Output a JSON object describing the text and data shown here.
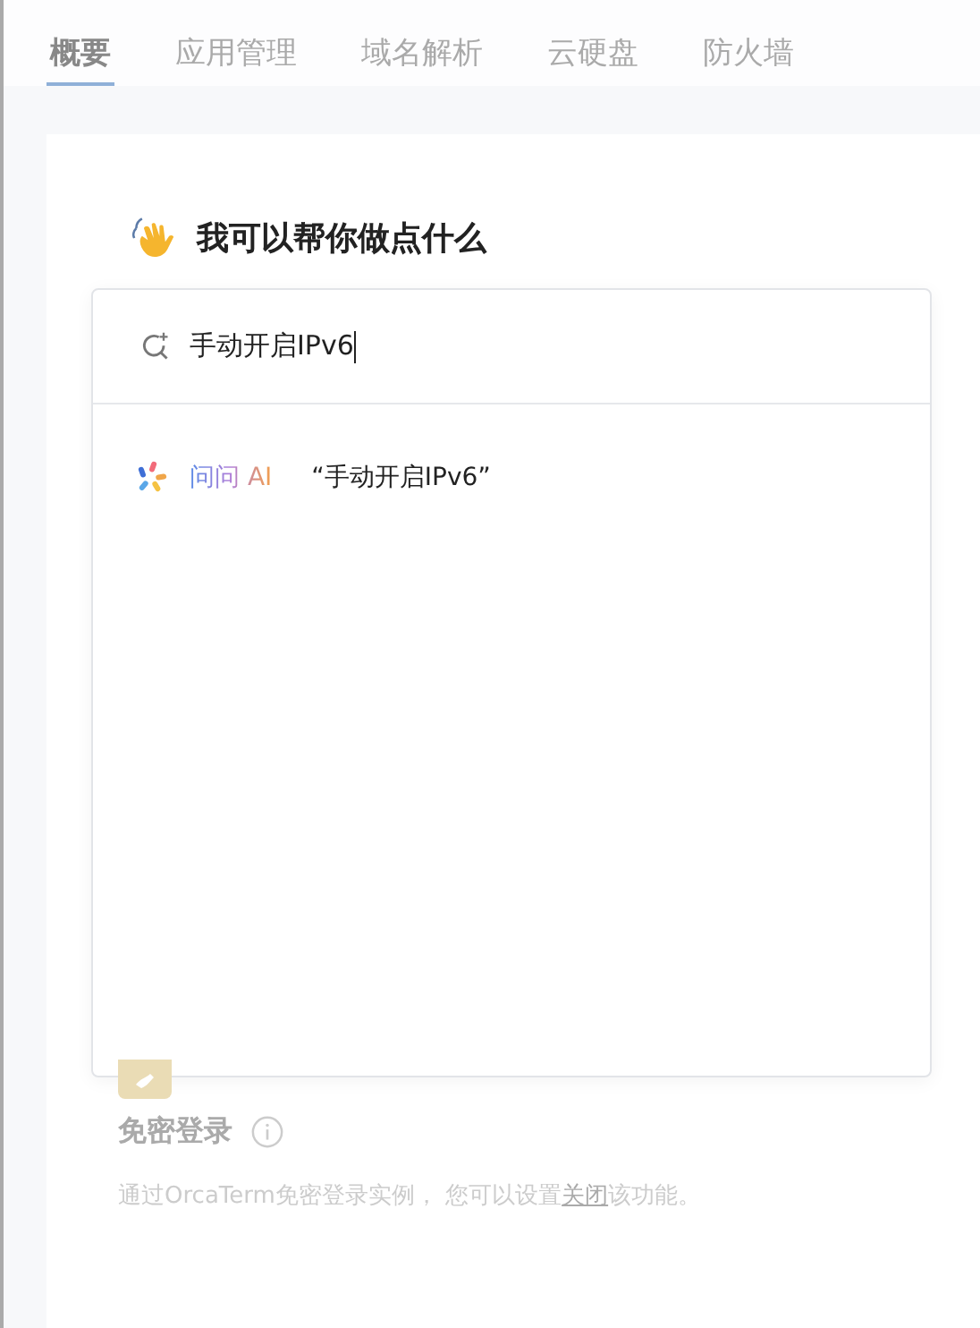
{
  "tabs": [
    {
      "label": "概要",
      "selected": true
    },
    {
      "label": "应用管理",
      "selected": false
    },
    {
      "label": "域名解析",
      "selected": false
    },
    {
      "label": "云硬盘",
      "selected": false
    },
    {
      "label": "防火墙",
      "selected": false
    }
  ],
  "assistant": {
    "heading": "我可以帮你做点什么",
    "search": {
      "value": "手动开启IPv6"
    },
    "suggestions": [
      {
        "label": "问问 AI",
        "query": "“手动开启IPv6”"
      }
    ]
  },
  "feature": {
    "title": "免密登录",
    "description_before": "通过OrcaTerm免密登录实例， 您可以设置",
    "link": "关闭",
    "description_after": "该功能。"
  }
}
